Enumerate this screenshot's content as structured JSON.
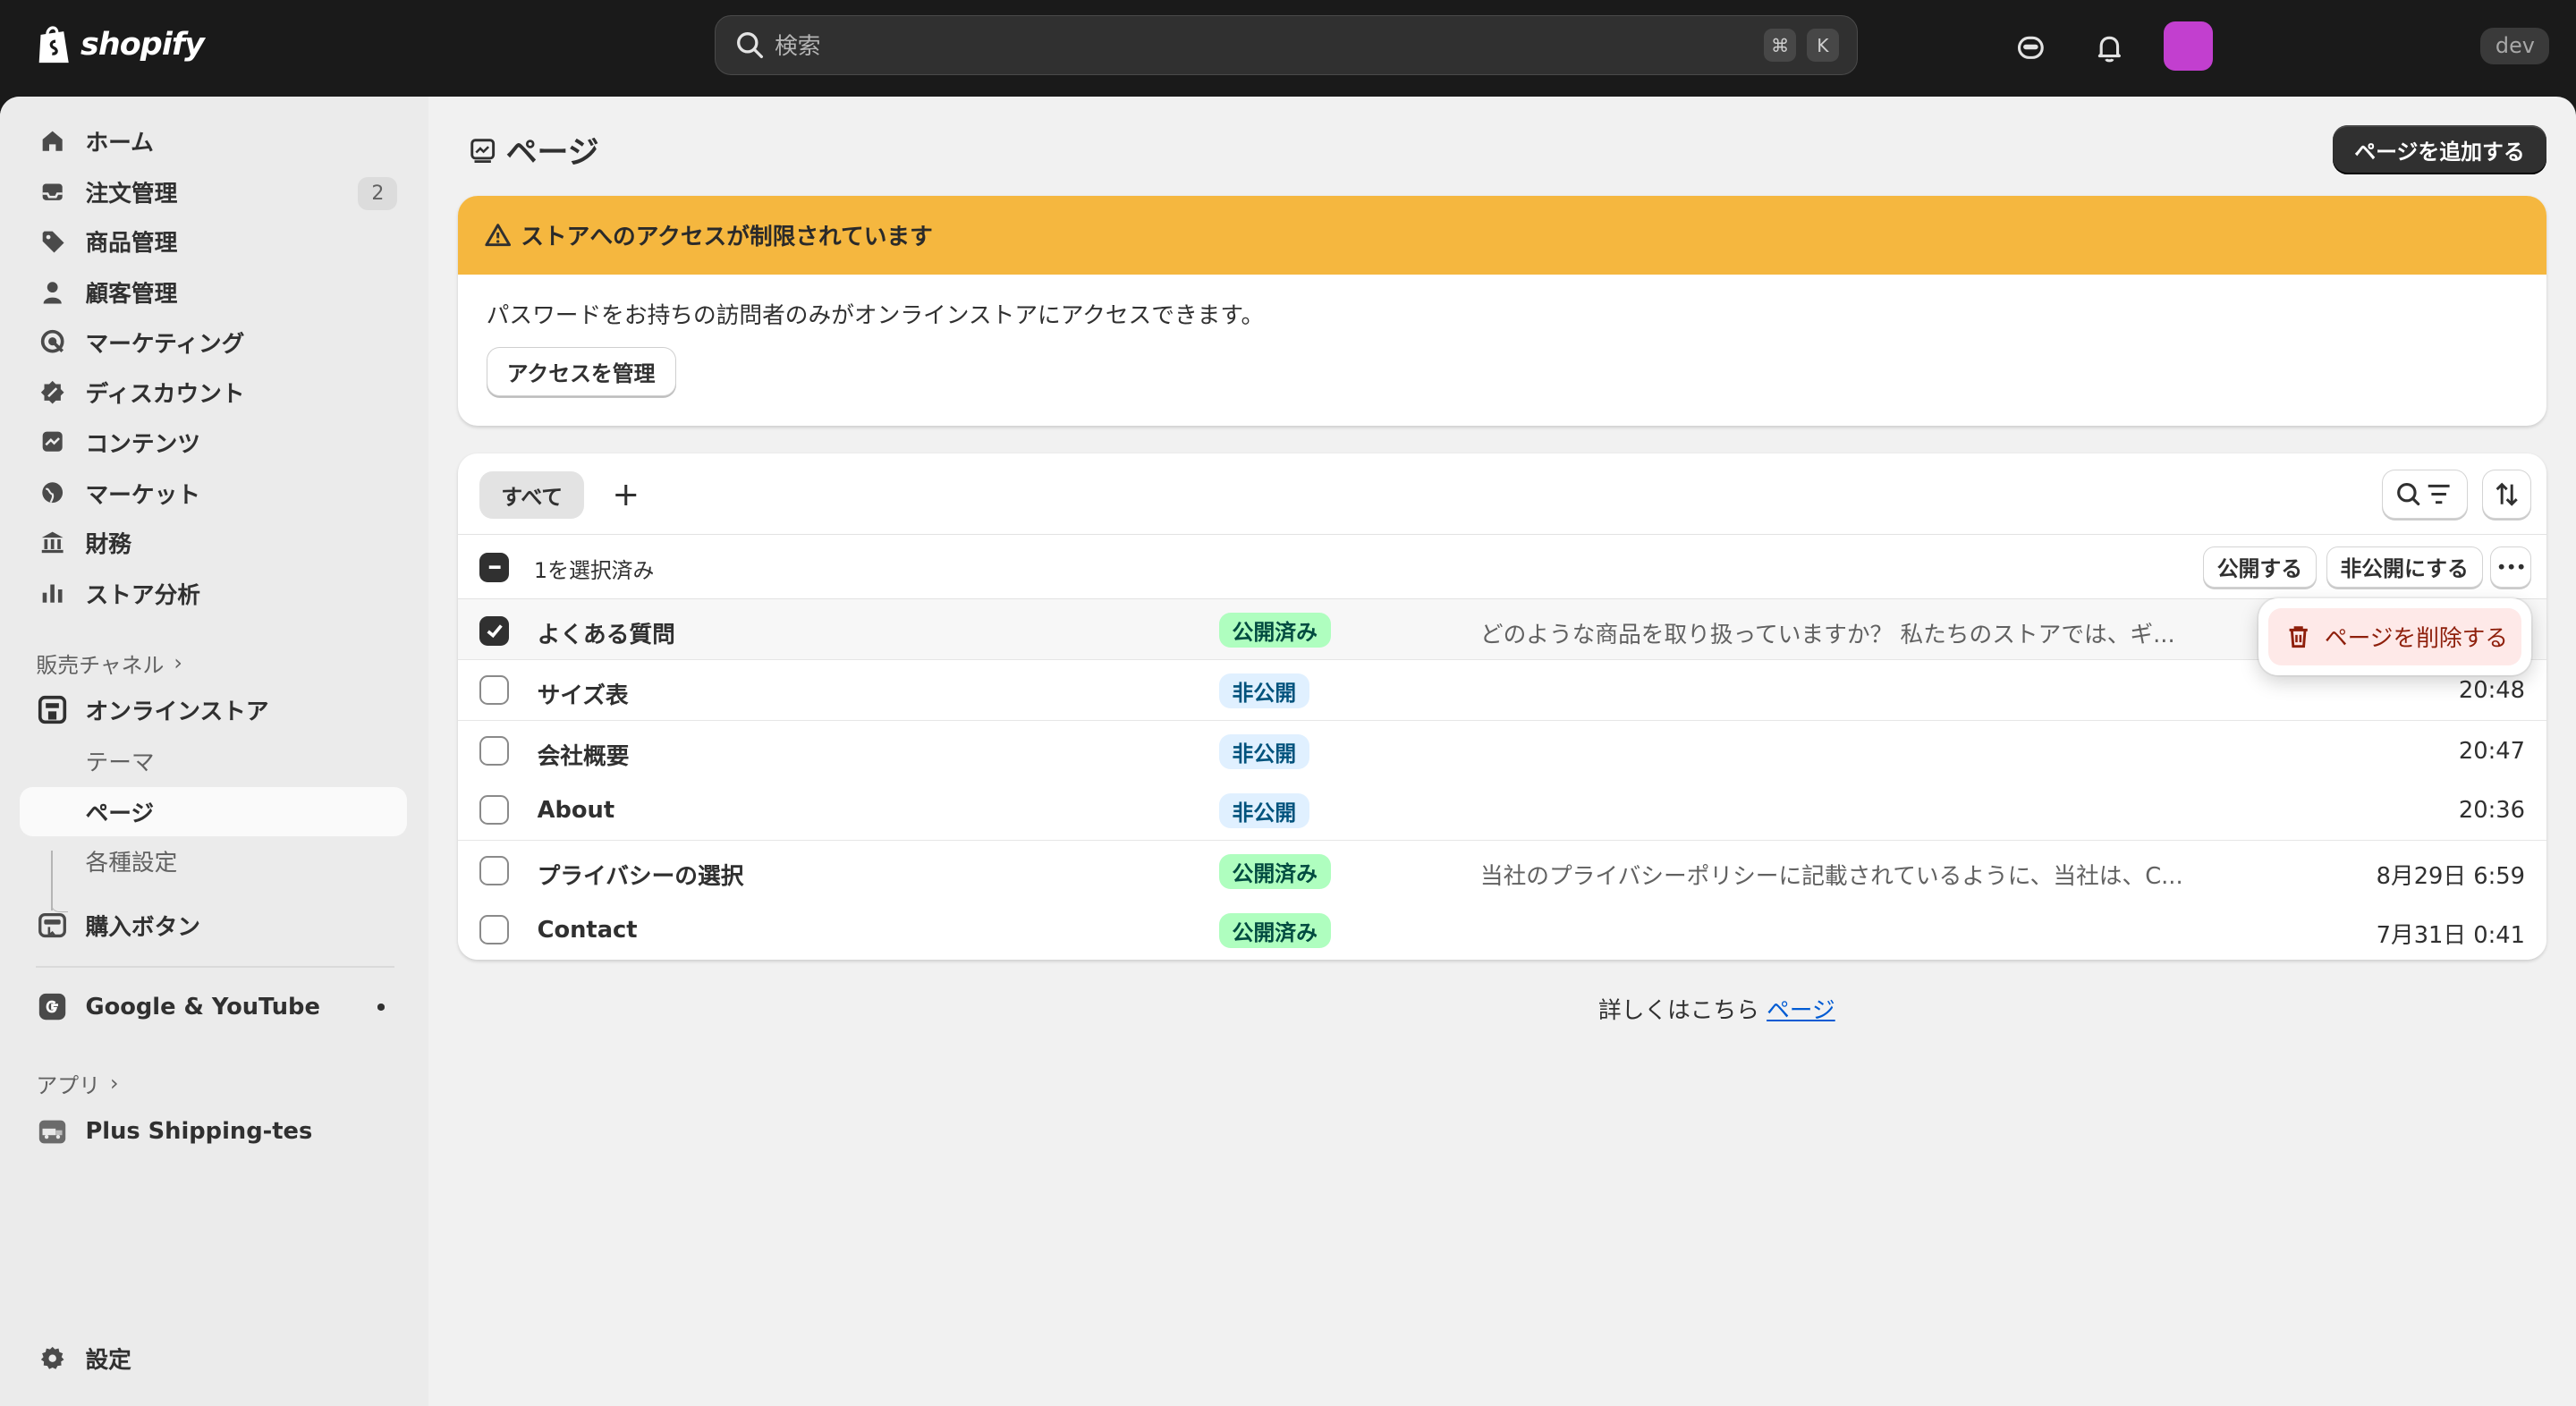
{
  "topbar": {
    "logo_text": "shopify",
    "search_placeholder": "検索",
    "shortcut_cmd": "⌘",
    "shortcut_key": "K",
    "store_badge": "dev"
  },
  "sidebar": {
    "items": [
      {
        "label": "ホーム",
        "icon": "home-icon"
      },
      {
        "label": "注文管理",
        "icon": "inbox-icon",
        "badge": "2"
      },
      {
        "label": "商品管理",
        "icon": "tag-icon"
      },
      {
        "label": "顧客管理",
        "icon": "person-icon"
      },
      {
        "label": "マーケティング",
        "icon": "target-icon"
      },
      {
        "label": "ディスカウント",
        "icon": "discount-icon"
      },
      {
        "label": "コンテンツ",
        "icon": "content-icon"
      },
      {
        "label": "マーケット",
        "icon": "globe-icon"
      },
      {
        "label": "財務",
        "icon": "bank-icon"
      },
      {
        "label": "ストア分析",
        "icon": "chart-icon"
      }
    ],
    "sales_channels_label": "販売チャネル",
    "online_store": "オンラインストア",
    "online_store_sub": [
      "テーマ",
      "ページ",
      "各種設定"
    ],
    "buy_button": "購入ボタン",
    "google": "Google & YouTube",
    "apps_label": "アプリ",
    "app_item": "Plus Shipping-tes",
    "settings": "設定"
  },
  "page": {
    "title": "ページ",
    "add_button": "ページを追加する"
  },
  "banner": {
    "title": "ストアへのアクセスが制限されています",
    "body": "パスワードをお持ちの訪問者のみがオンラインストアにアクセスできます。",
    "button": "アクセスを管理",
    "color": "#f5b73f"
  },
  "table": {
    "tab_all": "すべて",
    "tab_add": "+",
    "selected_text": "1を選択済み",
    "publish_button": "公開する",
    "unpublish_button": "非公開にする",
    "more_button": "•••",
    "rows": [
      {
        "title": "よくある質問",
        "status": "公開済み",
        "status_type": "published",
        "excerpt": "どのような商品を取り扱っていますか？ 私たちのストアでは、ギ...",
        "date": "",
        "checked": true
      },
      {
        "title": "サイズ表",
        "status": "非公開",
        "status_type": "hidden",
        "excerpt": "",
        "date": "20:48",
        "checked": false
      },
      {
        "title": "会社概要",
        "status": "非公開",
        "status_type": "hidden",
        "excerpt": "",
        "date": "20:47",
        "checked": false
      },
      {
        "title": "About",
        "status": "非公開",
        "status_type": "hidden",
        "excerpt": "",
        "date": "20:36",
        "checked": false
      },
      {
        "title": "プライバシーの選択",
        "status": "公開済み",
        "status_type": "published",
        "excerpt": "当社のプライバシーポリシーに記載されているように、当社は、C...",
        "date": "8月29日 6:59",
        "checked": false
      },
      {
        "title": "Contact",
        "status": "公開済み",
        "status_type": "published",
        "excerpt": "",
        "date": "7月31日 0:41",
        "checked": false
      }
    ]
  },
  "popover": {
    "delete_label": "ページを削除する"
  },
  "footer": {
    "text": "詳しくはこちら",
    "link": "ページ"
  }
}
